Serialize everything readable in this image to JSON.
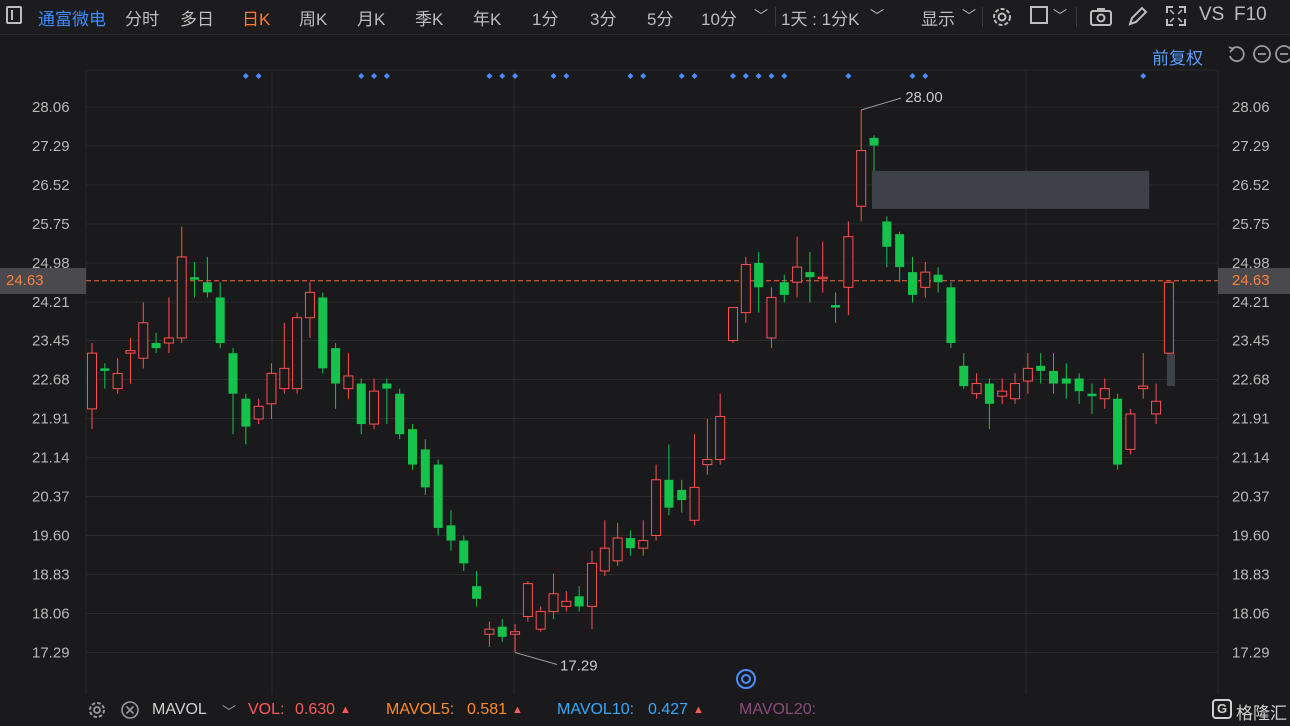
{
  "toolbar": {
    "stock_name": "通富微电",
    "tabs": [
      "分时",
      "多日",
      "日K",
      "周K",
      "月K",
      "季K",
      "年K",
      "1分",
      "3分",
      "5分",
      "10分"
    ],
    "active_tab": "日K",
    "interval_select": "1天 : 1分K",
    "display_label": "显示",
    "vs_label": "VS",
    "f10_label": "F10"
  },
  "chart": {
    "adjust_label": "前复权",
    "current_price": "24.63",
    "high_label": "28.00",
    "low_label": "17.29",
    "colors": {
      "up": "#ff4f4f",
      "down": "#15c34c",
      "dashed": "#ff6a2a",
      "grid": "#2b2b2e",
      "marker": "#4a8cff"
    }
  },
  "chart_data": {
    "type": "candlestick",
    "y_ticks": [
      "28.06",
      "27.29",
      "26.52",
      "25.75",
      "24.98",
      "24.21",
      "23.45",
      "22.68",
      "21.91",
      "21.14",
      "20.37",
      "19.60",
      "18.83",
      "18.06",
      "17.29"
    ],
    "ylim": [
      16.9,
      28.6
    ],
    "candles": [
      {
        "o": 22.1,
        "c": 23.2,
        "h": 23.4,
        "l": 21.7
      },
      {
        "o": 22.9,
        "c": 22.85,
        "h": 23.0,
        "l": 22.5
      },
      {
        "o": 22.5,
        "c": 22.8,
        "h": 23.1,
        "l": 22.4
      },
      {
        "o": 23.2,
        "c": 23.25,
        "h": 23.5,
        "l": 22.6
      },
      {
        "o": 23.1,
        "c": 23.8,
        "h": 24.2,
        "l": 22.9
      },
      {
        "o": 23.4,
        "c": 23.3,
        "h": 23.6,
        "l": 23.2
      },
      {
        "o": 23.4,
        "c": 23.5,
        "h": 24.3,
        "l": 23.2
      },
      {
        "o": 23.5,
        "c": 25.1,
        "h": 25.7,
        "l": 23.4
      },
      {
        "o": 24.7,
        "c": 24.65,
        "h": 25.0,
        "l": 24.3
      },
      {
        "o": 24.6,
        "c": 24.4,
        "h": 25.1,
        "l": 24.3
      },
      {
        "o": 24.3,
        "c": 23.4,
        "h": 24.6,
        "l": 23.3
      },
      {
        "o": 23.2,
        "c": 22.4,
        "h": 23.3,
        "l": 21.6
      },
      {
        "o": 22.3,
        "c": 21.75,
        "h": 22.4,
        "l": 21.4
      },
      {
        "o": 21.9,
        "c": 22.15,
        "h": 22.3,
        "l": 21.8
      },
      {
        "o": 22.2,
        "c": 22.8,
        "h": 23.0,
        "l": 21.9
      },
      {
        "o": 22.5,
        "c": 22.9,
        "h": 23.8,
        "l": 22.4
      },
      {
        "o": 22.5,
        "c": 23.9,
        "h": 24.0,
        "l": 22.4
      },
      {
        "o": 23.9,
        "c": 24.4,
        "h": 24.6,
        "l": 23.5
      },
      {
        "o": 24.3,
        "c": 22.9,
        "h": 24.4,
        "l": 22.8
      },
      {
        "o": 23.3,
        "c": 22.6,
        "h": 23.4,
        "l": 22.1
      },
      {
        "o": 22.5,
        "c": 22.75,
        "h": 23.2,
        "l": 22.3
      },
      {
        "o": 22.6,
        "c": 21.8,
        "h": 22.7,
        "l": 21.6
      },
      {
        "o": 21.8,
        "c": 22.45,
        "h": 22.7,
        "l": 21.7
      },
      {
        "o": 22.6,
        "c": 22.5,
        "h": 22.7,
        "l": 21.8
      },
      {
        "o": 22.4,
        "c": 21.6,
        "h": 22.5,
        "l": 21.5
      },
      {
        "o": 21.7,
        "c": 21.0,
        "h": 21.8,
        "l": 20.9
      },
      {
        "o": 21.3,
        "c": 20.55,
        "h": 21.5,
        "l": 20.4
      },
      {
        "o": 21.0,
        "c": 19.75,
        "h": 21.1,
        "l": 19.6
      },
      {
        "o": 19.8,
        "c": 19.5,
        "h": 20.1,
        "l": 19.3
      },
      {
        "o": 19.5,
        "c": 19.05,
        "h": 19.6,
        "l": 18.9
      },
      {
        "o": 18.6,
        "c": 18.35,
        "h": 18.9,
        "l": 18.2
      },
      {
        "o": 17.65,
        "c": 17.75,
        "h": 17.9,
        "l": 17.4
      },
      {
        "o": 17.8,
        "c": 17.6,
        "h": 17.95,
        "l": 17.5
      },
      {
        "o": 17.65,
        "c": 17.7,
        "h": 17.85,
        "l": 17.29
      },
      {
        "o": 18.0,
        "c": 18.65,
        "h": 18.7,
        "l": 17.9
      },
      {
        "o": 17.75,
        "c": 18.1,
        "h": 18.2,
        "l": 17.7
      },
      {
        "o": 18.1,
        "c": 18.45,
        "h": 18.85,
        "l": 17.95
      },
      {
        "o": 18.2,
        "c": 18.3,
        "h": 18.5,
        "l": 18.1
      },
      {
        "o": 18.4,
        "c": 18.2,
        "h": 18.6,
        "l": 18.1
      },
      {
        "o": 18.2,
        "c": 19.05,
        "h": 19.3,
        "l": 17.75
      },
      {
        "o": 18.9,
        "c": 19.35,
        "h": 19.9,
        "l": 18.8
      },
      {
        "o": 19.1,
        "c": 19.55,
        "h": 19.85,
        "l": 19.0
      },
      {
        "o": 19.55,
        "c": 19.35,
        "h": 19.7,
        "l": 19.2
      },
      {
        "o": 19.35,
        "c": 19.5,
        "h": 19.9,
        "l": 19.2
      },
      {
        "o": 19.6,
        "c": 20.7,
        "h": 21.0,
        "l": 19.5
      },
      {
        "o": 20.7,
        "c": 20.15,
        "h": 21.4,
        "l": 20.0
      },
      {
        "o": 20.5,
        "c": 20.3,
        "h": 20.7,
        "l": 20.05
      },
      {
        "o": 19.9,
        "c": 20.55,
        "h": 21.6,
        "l": 19.8
      },
      {
        "o": 21.0,
        "c": 21.1,
        "h": 21.9,
        "l": 20.8
      },
      {
        "o": 21.1,
        "c": 21.95,
        "h": 22.4,
        "l": 21.0
      },
      {
        "o": 23.45,
        "c": 24.1,
        "h": 24.1,
        "l": 23.4
      },
      {
        "o": 24.0,
        "c": 24.95,
        "h": 25.1,
        "l": 23.8
      },
      {
        "o": 24.98,
        "c": 24.5,
        "h": 25.2,
        "l": 24.0
      },
      {
        "o": 23.5,
        "c": 24.3,
        "h": 24.5,
        "l": 23.3
      },
      {
        "o": 24.6,
        "c": 24.35,
        "h": 24.75,
        "l": 24.2
      },
      {
        "o": 24.6,
        "c": 24.9,
        "h": 25.5,
        "l": 24.3
      },
      {
        "o": 24.8,
        "c": 24.7,
        "h": 25.2,
        "l": 24.2
      },
      {
        "o": 24.7,
        "c": 24.7,
        "h": 25.4,
        "l": 24.4
      },
      {
        "o": 24.15,
        "c": 24.1,
        "h": 24.4,
        "l": 23.8
      },
      {
        "o": 24.5,
        "c": 25.5,
        "h": 25.8,
        "l": 23.95
      },
      {
        "o": 26.1,
        "c": 27.2,
        "h": 28.0,
        "l": 25.8
      },
      {
        "o": 27.45,
        "c": 27.3,
        "h": 27.5,
        "l": 26.8
      },
      {
        "o": 25.8,
        "c": 25.3,
        "h": 25.9,
        "l": 24.9
      },
      {
        "o": 25.55,
        "c": 24.9,
        "h": 25.6,
        "l": 24.6
      },
      {
        "o": 24.8,
        "c": 24.35,
        "h": 25.1,
        "l": 24.2
      },
      {
        "o": 24.5,
        "c": 24.8,
        "h": 25.0,
        "l": 24.3
      },
      {
        "o": 24.75,
        "c": 24.6,
        "h": 24.9,
        "l": 24.4
      },
      {
        "o": 24.5,
        "c": 23.4,
        "h": 24.6,
        "l": 23.3
      },
      {
        "o": 22.95,
        "c": 22.55,
        "h": 23.2,
        "l": 22.5
      },
      {
        "o": 22.4,
        "c": 22.6,
        "h": 22.8,
        "l": 22.3
      },
      {
        "o": 22.6,
        "c": 22.2,
        "h": 22.7,
        "l": 21.7
      },
      {
        "o": 22.35,
        "c": 22.45,
        "h": 22.7,
        "l": 22.2
      },
      {
        "o": 22.3,
        "c": 22.6,
        "h": 22.8,
        "l": 22.2
      },
      {
        "o": 22.65,
        "c": 22.9,
        "h": 23.2,
        "l": 22.4
      },
      {
        "o": 22.95,
        "c": 22.85,
        "h": 23.2,
        "l": 22.6
      },
      {
        "o": 22.85,
        "c": 22.6,
        "h": 23.2,
        "l": 22.4
      },
      {
        "o": 22.7,
        "c": 22.6,
        "h": 23.0,
        "l": 22.3
      },
      {
        "o": 22.7,
        "c": 22.45,
        "h": 22.8,
        "l": 22.2
      },
      {
        "o": 22.4,
        "c": 22.35,
        "h": 22.6,
        "l": 22.0
      },
      {
        "o": 22.3,
        "c": 22.5,
        "h": 22.7,
        "l": 22.1
      },
      {
        "o": 22.3,
        "c": 21.0,
        "h": 22.4,
        "l": 20.9
      },
      {
        "o": 21.3,
        "c": 22.0,
        "h": 22.1,
        "l": 21.2
      },
      {
        "o": 22.5,
        "c": 22.55,
        "h": 23.2,
        "l": 22.3
      },
      {
        "o": 22.0,
        "c": 22.25,
        "h": 22.6,
        "l": 21.8
      },
      {
        "o": 23.2,
        "c": 24.6,
        "h": 24.6,
        "l": 23.2
      }
    ],
    "markers": [
      12,
      13,
      21,
      22,
      23,
      31,
      32,
      33,
      36,
      37,
      42,
      43,
      46,
      47,
      50,
      51,
      52,
      53,
      54,
      59,
      64,
      65,
      82
    ],
    "grey_zones": [
      {
        "from_index": 61,
        "to_index": 82,
        "y_top": 26.8,
        "y_bottom": 26.05
      },
      {
        "from_index": 84,
        "to_index": 84,
        "y_top": 23.2,
        "y_bottom": 22.55
      }
    ]
  },
  "bottom": {
    "indicator": "MAVOL",
    "vol_label": "VOL:",
    "vol_value": "0.630",
    "mavol5_label": "MAVOL5:",
    "mavol5_value": "0.581",
    "mavol10_label": "MAVOL10:",
    "mavol10_value": "0.427",
    "mavol20_label": "MAVOL20:",
    "brand": "格隆汇"
  }
}
